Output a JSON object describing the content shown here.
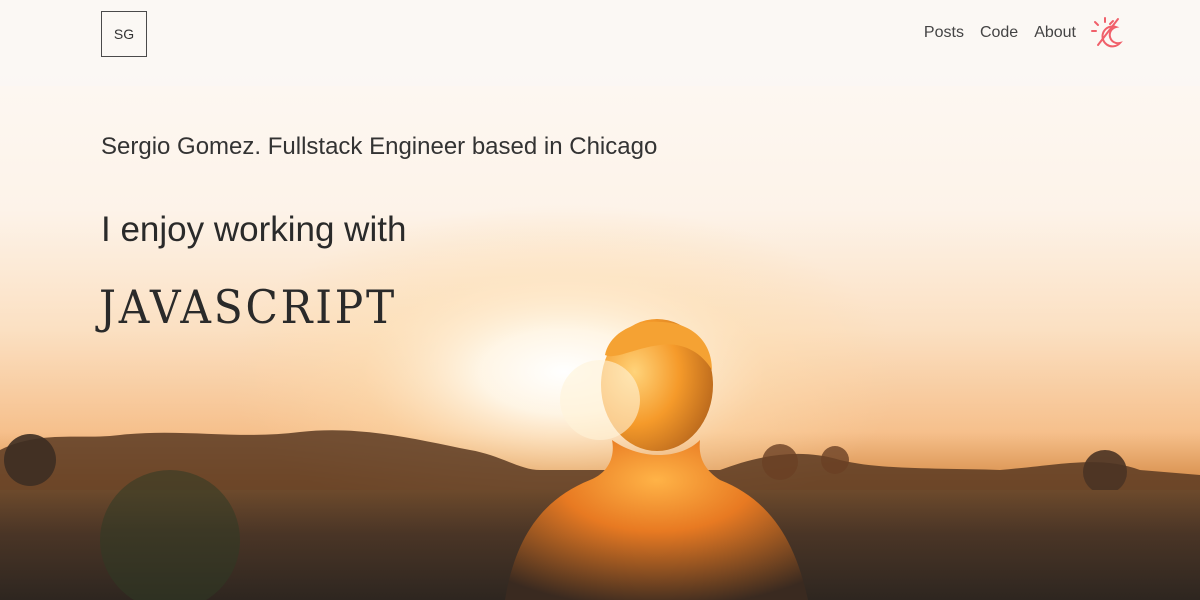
{
  "header": {
    "logo_text": "SG",
    "nav": [
      {
        "label": "Posts"
      },
      {
        "label": "Code"
      },
      {
        "label": "About"
      }
    ],
    "theme_toggle_icon": "sun-moon-icon",
    "accent_color": "#f0606a"
  },
  "hero": {
    "tagline": "Sergio Gomez. Fullstack Engineer based in Chicago",
    "heading": "I enjoy working with",
    "technology": "JAVASCRIPT",
    "background": "sunset-silhouette-photo"
  }
}
